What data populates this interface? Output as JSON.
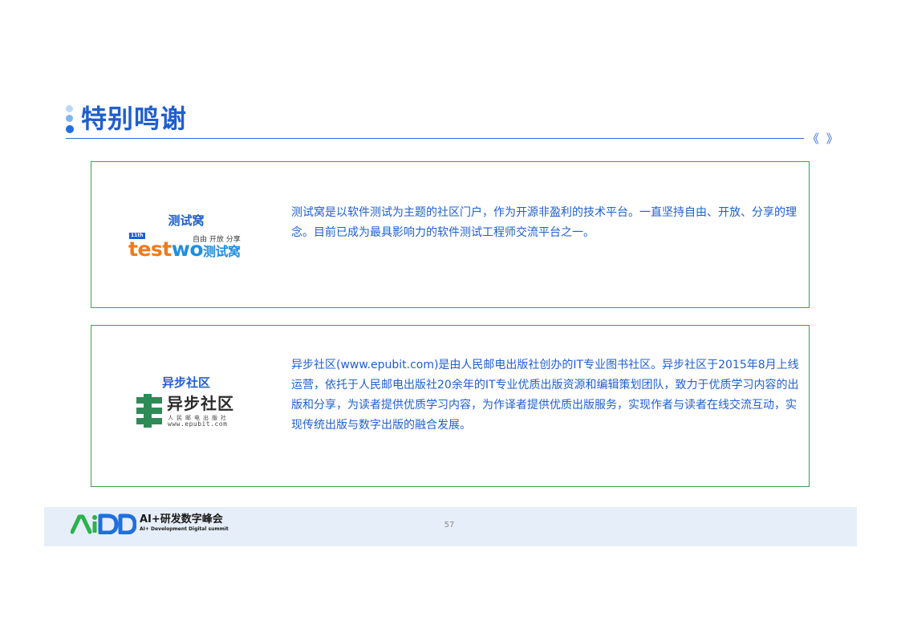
{
  "header": {
    "title": "特别鸣谢",
    "nav_arrows": "《 》"
  },
  "cards": [
    {
      "name": "测试窝",
      "logo": {
        "badge": "11th",
        "slogan": "自由 开放 分享",
        "word_test": "test",
        "word_wo": "wo",
        "word_cn": "测试窝"
      },
      "description": "测试窝是以软件测试为主题的社区门户，作为开源非盈利的技术平台。一直坚持自由、开放、分享的理念。目前已成为最具影响力的软件测试工程师交流平台之一。"
    },
    {
      "name": "异步社区",
      "logo": {
        "name": "异步社区",
        "sub": "人民邮电出版社",
        "url": "www.epubit.com"
      },
      "description": "异步社区(www.epubit.com)是由人民邮电出版社创办的IT专业图书社区。异步社区于2015年8月上线运营，依托于人民邮电出版社20余年的IT专业优质出版资源和编辑策划团队，致力于优质学习内容的出版和分享，为读者提供优质学习内容，为作译者提供优质出版服务，实现作者与读者在线交流互动，实现传统出版与数字出版的融合发展。"
    }
  ],
  "footer": {
    "brand": "AI+研发数字峰会",
    "brand_sub": "AI+ Development Digital summit",
    "page_number": "57"
  },
  "colors": {
    "accent": "#1f5fcf",
    "card_border": "#3aa24a",
    "footer_bg": "#e6eef9",
    "logo_green": "#2bb24c",
    "logo_blue": "#1f6fe0"
  }
}
